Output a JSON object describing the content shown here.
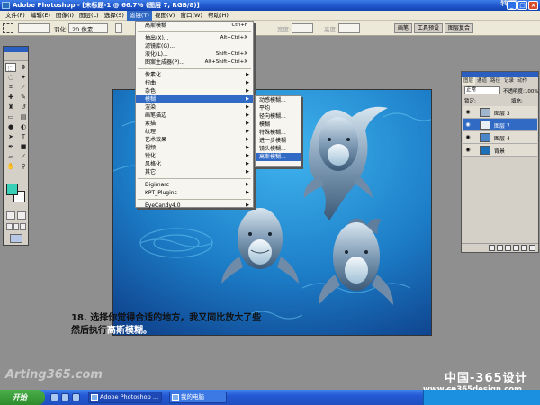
{
  "titlebar": {
    "title": "Adobe Photoshop - [未标题-1 @ 66.7% (图层 7, RGB/8)]",
    "watermark": "转载",
    "minimize": "_",
    "restore": "□",
    "close": "×"
  },
  "menubar": {
    "items": [
      "文件(F)",
      "编辑(E)",
      "图像(I)",
      "图层(L)",
      "选择(S)",
      "滤镜(T)",
      "视图(V)",
      "窗口(W)",
      "帮助(H)"
    ],
    "active_index": 5
  },
  "options_bar": {
    "feather_label": "羽化:",
    "feather_value": "20 像素",
    "width_label": "宽度:",
    "height_label": "高度:",
    "palette_tabs": [
      "画笔",
      "工具预设",
      "图层复合"
    ]
  },
  "filter_menu": {
    "items": [
      {
        "label": "高斯模糊",
        "shortcut": "Ctrl+F"
      },
      {
        "sep": true
      },
      {
        "label": "抽出(X)...",
        "shortcut": "Alt+Ctrl+X"
      },
      {
        "label": "滤镜库(G)...",
        "shortcut": ""
      },
      {
        "label": "液化(L)...",
        "shortcut": "Shift+Ctrl+X"
      },
      {
        "label": "图案生成器(P)...",
        "shortcut": "Alt+Shift+Ctrl+X"
      },
      {
        "sep": true
      },
      {
        "label": "像素化",
        "submenu": true
      },
      {
        "label": "扭曲",
        "submenu": true
      },
      {
        "label": "杂色",
        "submenu": true
      },
      {
        "label": "模糊",
        "submenu": true,
        "highlighted": true
      },
      {
        "label": "渲染",
        "submenu": true
      },
      {
        "label": "画笔描边",
        "submenu": true
      },
      {
        "label": "素描",
        "submenu": true
      },
      {
        "label": "纹理",
        "submenu": true
      },
      {
        "label": "艺术效果",
        "submenu": true
      },
      {
        "label": "视频",
        "submenu": true
      },
      {
        "label": "锐化",
        "submenu": true
      },
      {
        "label": "风格化",
        "submenu": true
      },
      {
        "label": "其它",
        "submenu": true
      },
      {
        "sep": true
      },
      {
        "label": "Digimarc",
        "submenu": true
      },
      {
        "label": "KPT_Plugins",
        "submenu": true
      },
      {
        "sep": true
      },
      {
        "label": "EyeCandy4.0",
        "submenu": true
      }
    ]
  },
  "blur_submenu": {
    "items": [
      "动感模糊...",
      "平均",
      "径向模糊...",
      "模糊",
      "特殊模糊...",
      "进一步模糊",
      "镜头模糊...",
      "高斯模糊..."
    ],
    "highlighted_index": 7
  },
  "layers_panel": {
    "tabs": [
      "图层",
      "通道",
      "路径",
      "记录",
      "动作"
    ],
    "blend_mode": "正常",
    "opacity_label": "不透明度:",
    "opacity_value": "100%",
    "lock_label": "锁定:",
    "fill_label": "填充:",
    "layers": [
      {
        "name": "图层 3",
        "selected": false
      },
      {
        "name": "图层 7",
        "selected": true
      },
      {
        "name": "图层 4",
        "selected": false
      },
      {
        "name": "背景",
        "selected": false
      }
    ]
  },
  "caption": {
    "line1": "18. 选择你觉得合适的地方，我又同比放大了些",
    "line2_prefix": "然后执行",
    "line2_highlight": "高斯模糊。"
  },
  "taskbar": {
    "start": "开始",
    "buttons": [
      {
        "label": "Adobe Photoshop ...",
        "active": true
      },
      {
        "label": "我的电脑",
        "active": false
      }
    ]
  },
  "watermarks": {
    "left": "Arting365.com",
    "right_title": "中国-365设计网",
    "right_url": "www.cn365design.com"
  },
  "colors": {
    "accent": "#316ac5",
    "foreground_swatch": "#38d0b6",
    "canvas_bg": "#8f8f8f",
    "water": "#1d7ec8"
  }
}
